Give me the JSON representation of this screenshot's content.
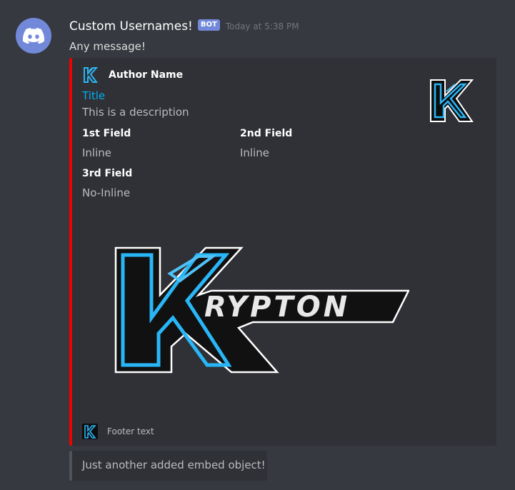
{
  "message": {
    "username": "Custom Usernames!",
    "bot_badge": "BOT",
    "timestamp": "Today at 5:38 PM",
    "content": "Any message!"
  },
  "embed": {
    "accent_color": "#f00000",
    "author_name": "Author Name",
    "title": "Title",
    "description": "This is a description",
    "fields": [
      {
        "name": "1st Field",
        "value": "Inline",
        "inline": true
      },
      {
        "name": "2nd Field",
        "value": "Inline",
        "inline": true
      },
      {
        "name": "3rd Field",
        "value": "No-Inline",
        "inline": false
      }
    ],
    "image_text": "RYPTON",
    "footer_text": "Footer text",
    "icons": [
      "krypton-logo-icon"
    ]
  },
  "embed2": {
    "description": "Just another added embed object!",
    "accent_color": "#4f545c"
  },
  "icons": {
    "avatar": "discord-logo-icon"
  }
}
